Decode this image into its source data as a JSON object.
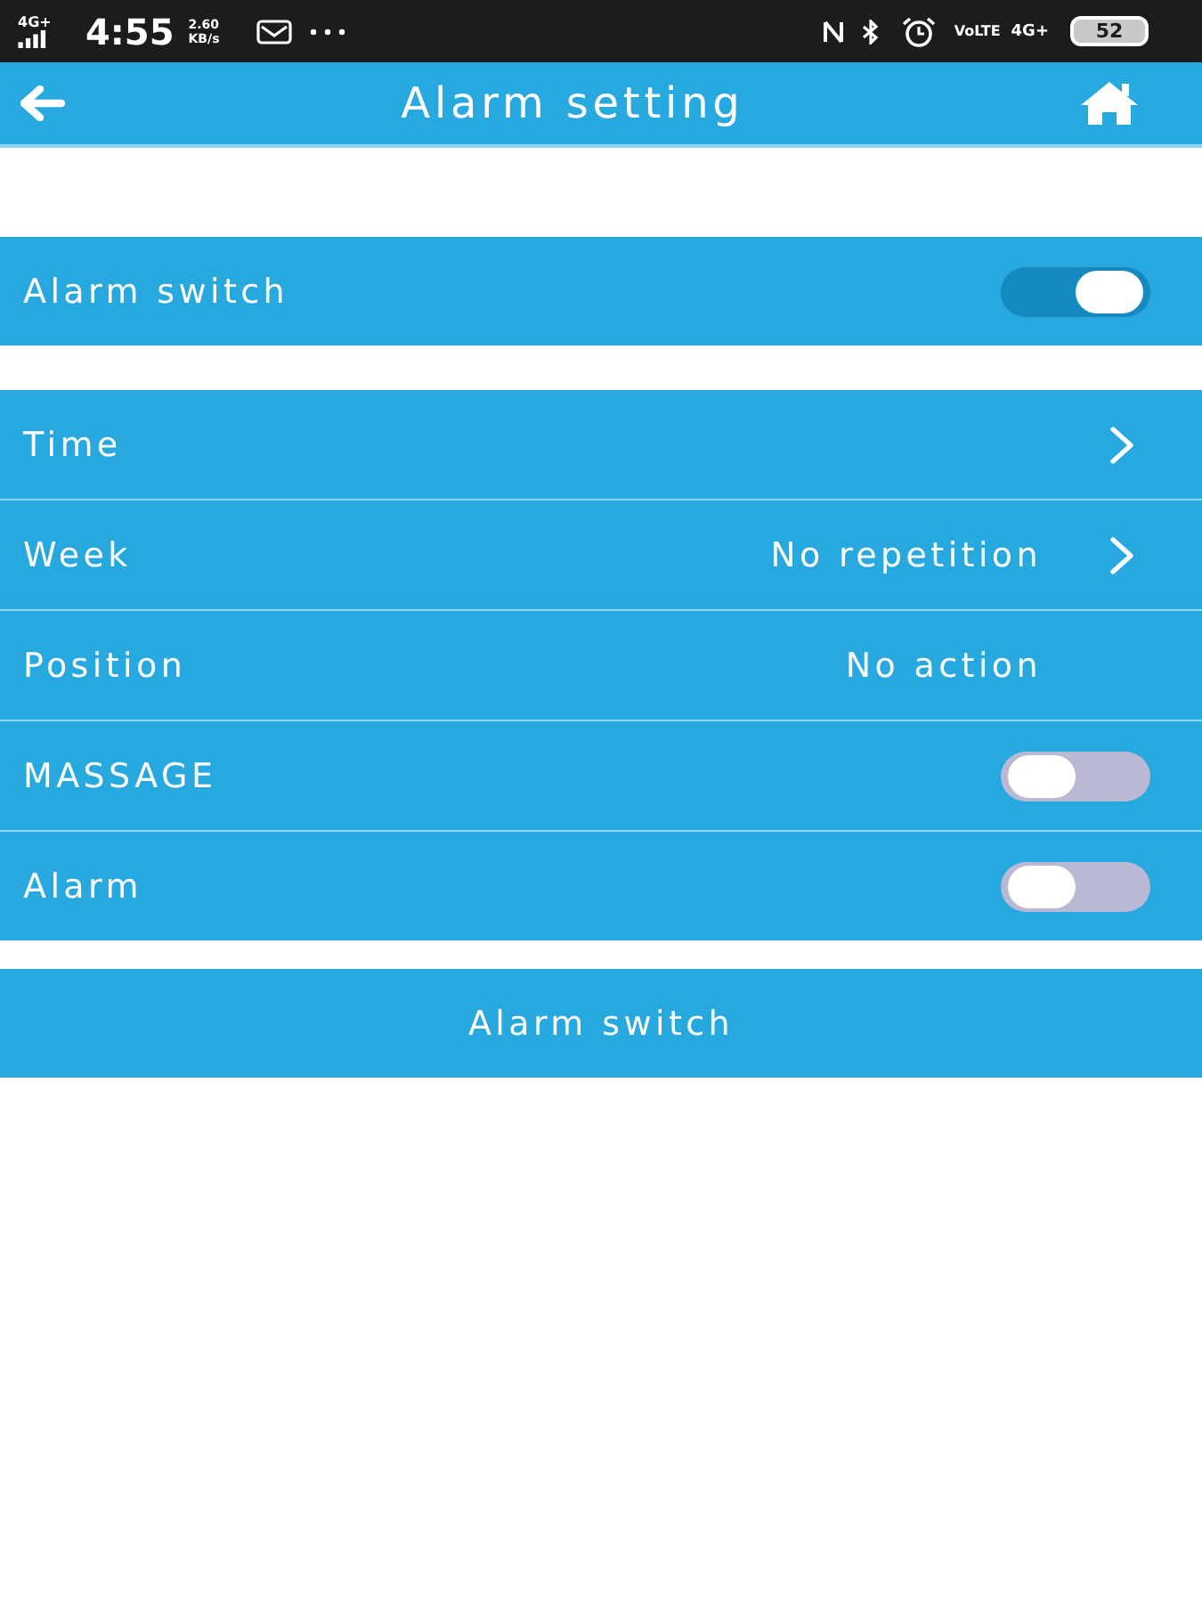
{
  "status_bar": {
    "network_left": "4G+",
    "time": "4:55",
    "net_speed": "2.60 KB/s",
    "volte": "VoLTE",
    "network_right": "4G+",
    "battery": "52"
  },
  "header": {
    "title": "Alarm setting"
  },
  "master": {
    "label": "Alarm switch",
    "on": true
  },
  "settings": [
    {
      "kind": "link",
      "label": "Time"
    },
    {
      "kind": "link",
      "label": "Week",
      "value": "No repetition"
    },
    {
      "kind": "value",
      "label": "Position",
      "value": "No action"
    },
    {
      "kind": "toggle",
      "label": "MASSAGE",
      "on": false
    },
    {
      "kind": "toggle",
      "label": "Alarm",
      "on": false
    }
  ],
  "button": {
    "label": "Alarm switch"
  }
}
